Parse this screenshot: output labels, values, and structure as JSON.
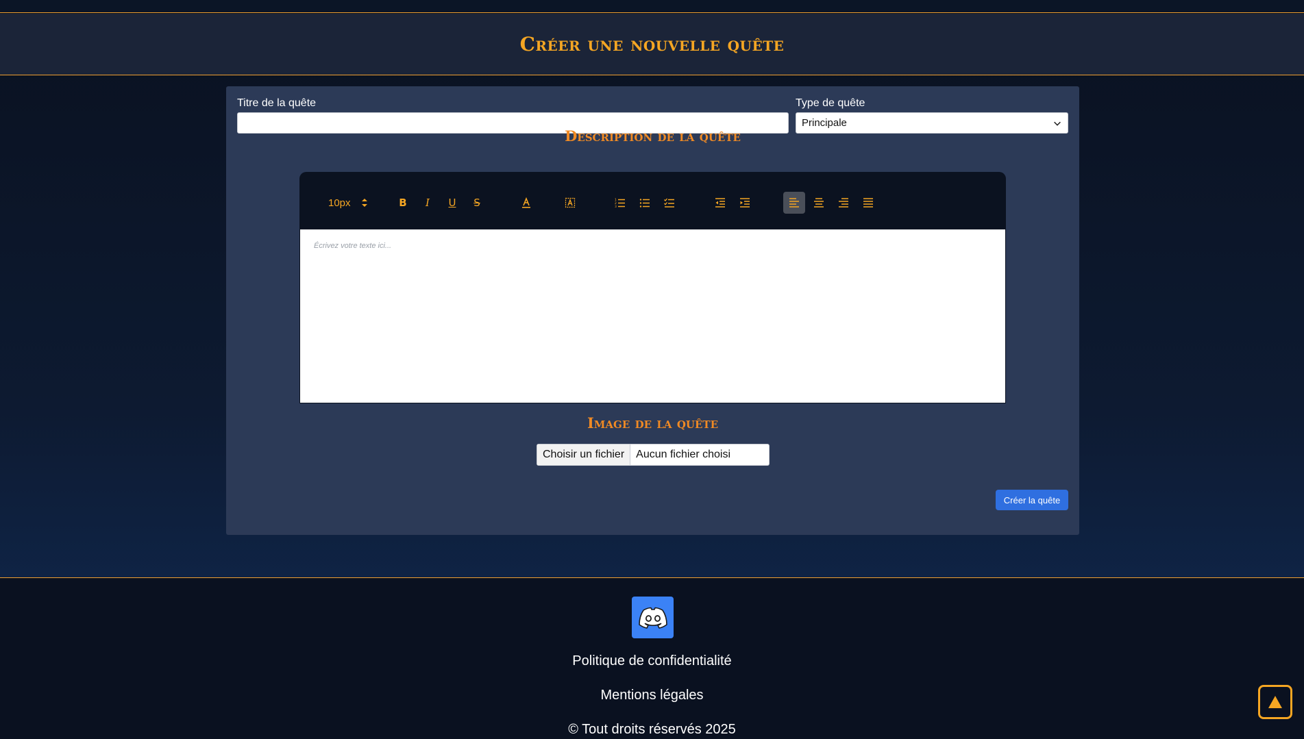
{
  "header": {
    "title": "Créer une nouvelle quête"
  },
  "form": {
    "title_label": "Titre de la quête",
    "title_value": "",
    "type_label": "Type de quête",
    "type_selected": "Principale"
  },
  "description": {
    "section_title": "Description de la quête",
    "font_size": "10px",
    "placeholder": "Écrivez votre texte ici...",
    "toolbar_icons": [
      "bold-icon",
      "italic-icon",
      "underline-icon",
      "strikethrough-icon",
      "text-color-icon",
      "highlight-icon",
      "ordered-list-icon",
      "bullet-list-icon",
      "checklist-icon",
      "outdent-icon",
      "indent-icon",
      "align-left-icon",
      "align-center-icon",
      "align-right-icon",
      "align-justify-icon"
    ],
    "active_alignment": "align-left"
  },
  "image": {
    "section_title": "Image de la quête",
    "choose_label": "Choisir un fichier",
    "no_file_label": "Aucun fichier choisi"
  },
  "actions": {
    "submit_label": "Créer la quête"
  },
  "footer": {
    "social_icon": "discord-icon",
    "privacy_link": "Politique de confidentialité",
    "legal_link": "Mentions légales",
    "copyright": "© Tout droits réservés 2025"
  },
  "colors": {
    "accent": "#f5a623",
    "card_bg": "#2c3a57",
    "header_bg": "#1b2438",
    "primary_button": "#2f6fe0",
    "discord_bg": "#3b82f6"
  }
}
